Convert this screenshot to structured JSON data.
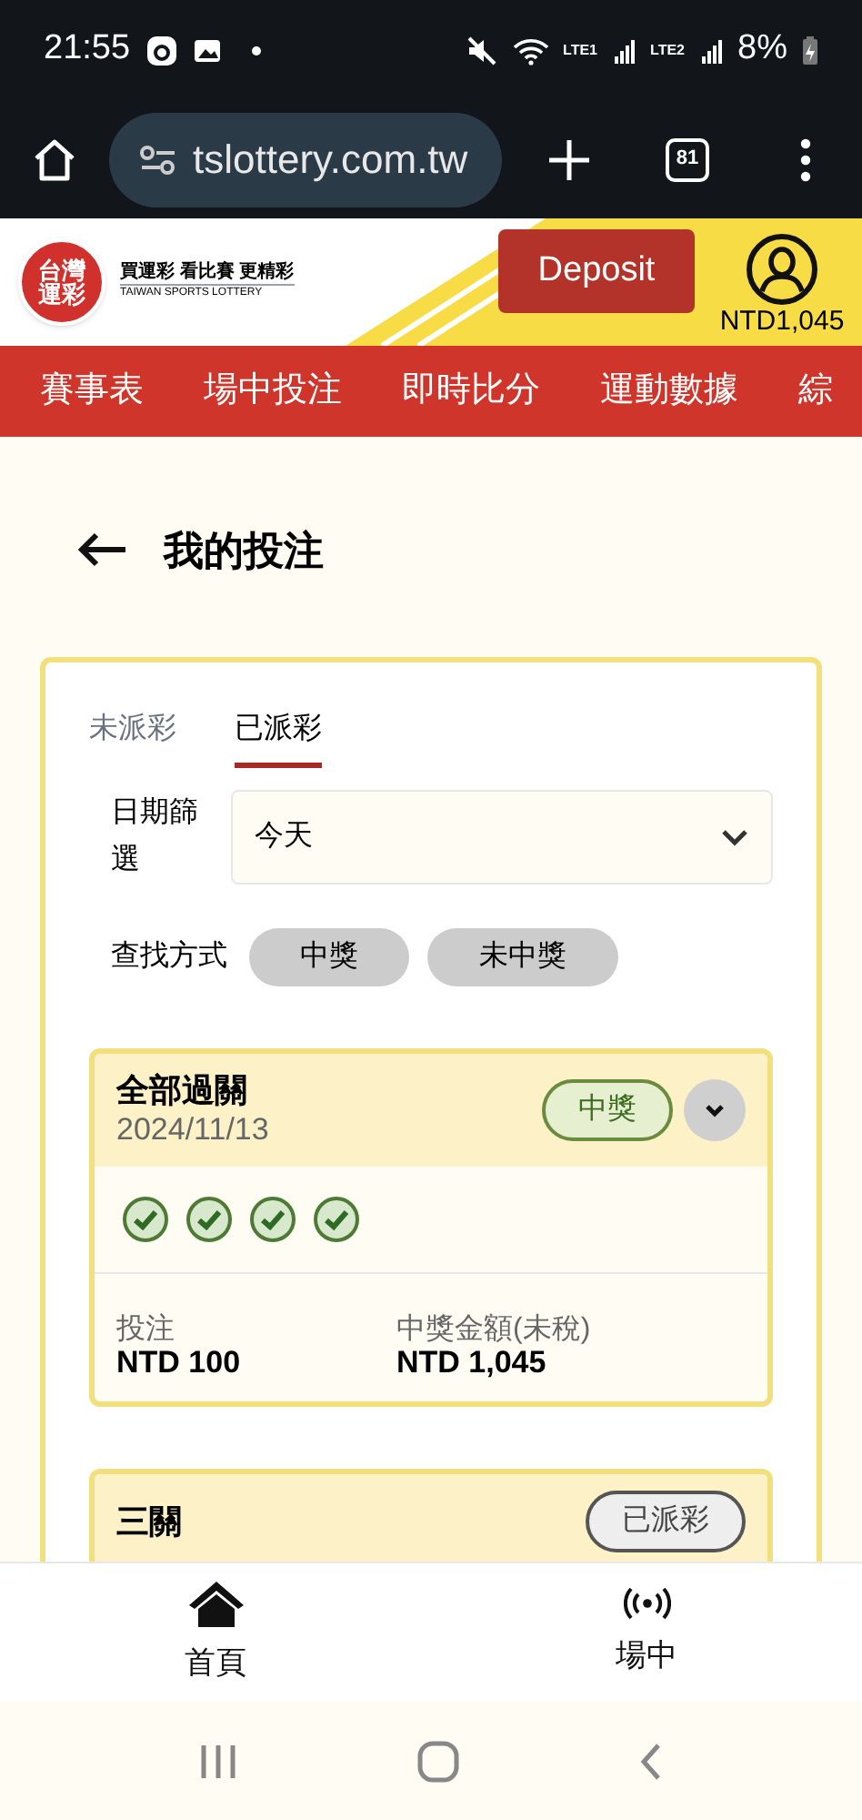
{
  "status_bar": {
    "time": "21:55",
    "sim1": "LTE1",
    "sim2": "LTE2",
    "battery": "8%"
  },
  "browser": {
    "url": "tslottery.com.tw",
    "tab_count": "81"
  },
  "header": {
    "logo": "台灣運彩",
    "tagline": "買運彩 看比賽 更精彩",
    "tagline_en": "TAIWAN SPORTS LOTTERY",
    "deposit": "Deposit",
    "balance": "NTD1,045"
  },
  "nav": [
    "賽事表",
    "場中投注",
    "即時比分",
    "運動數據",
    "綜"
  ],
  "page_title": "我的投注",
  "tabs": [
    {
      "label": "未派彩",
      "selected": false
    },
    {
      "label": "已派彩",
      "selected": true
    }
  ],
  "date_filter": {
    "label": "日期篩選",
    "value": "今天"
  },
  "search_by": {
    "label": "查找方式",
    "options": [
      {
        "label": "中獎",
        "selected": false
      },
      {
        "label": "未中獎",
        "selected": false
      }
    ]
  },
  "bets": [
    {
      "title": "全部過關",
      "date": "2024/11/13",
      "status": "中獎",
      "kind": "won",
      "expanded": false,
      "legs": [
        {
          "won": true
        },
        {
          "won": true
        },
        {
          "won": true
        },
        {
          "won": true
        }
      ],
      "stake_label": "投注",
      "stake": "NTD 100",
      "payout_label": "中獎金額(未稅)",
      "payout": "NTD 1,045"
    },
    {
      "title": "三關",
      "status": "已派彩",
      "kind": "settled"
    }
  ],
  "bottom_nav": [
    {
      "label": "首頁",
      "kind": "home"
    },
    {
      "label": "場中",
      "kind": "live"
    }
  ]
}
